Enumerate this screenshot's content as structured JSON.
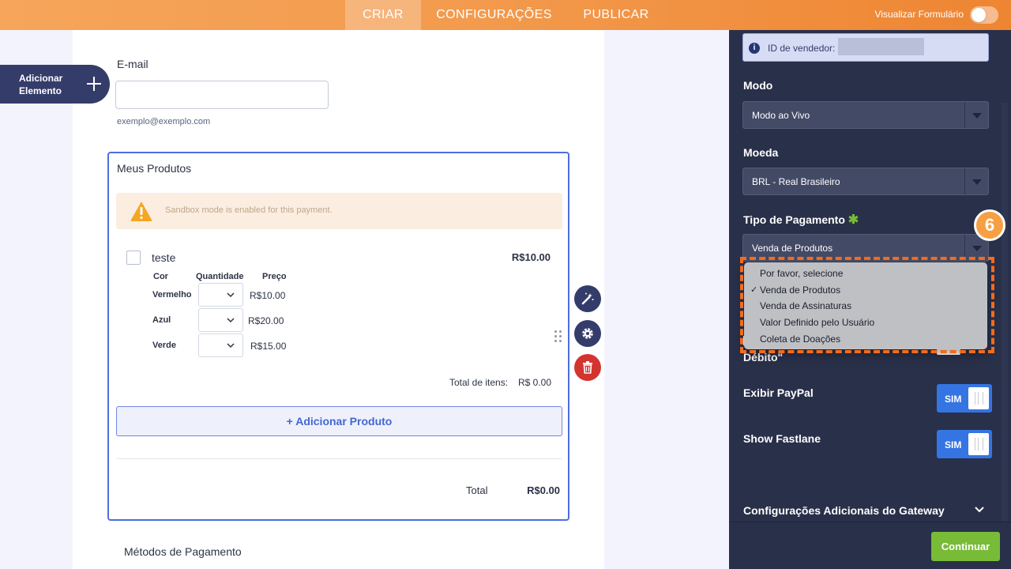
{
  "topbar": {
    "tabs": [
      {
        "label": "CRIAR",
        "active": true
      },
      {
        "label": "CONFIGURAÇÕES",
        "active": false
      },
      {
        "label": "PUBLICAR",
        "active": false
      }
    ],
    "preview_label": "Visualizar Formulário",
    "preview_on": false
  },
  "add_element": {
    "label_line1": "Adicionar",
    "label_line2": "Elemento"
  },
  "email": {
    "label": "E-mail",
    "value": "",
    "sublabel": "exemplo@exemplo.com"
  },
  "products": {
    "title": "Meus Produtos",
    "sandbox_notice": "Sandbox mode is enabled for this payment.",
    "product": {
      "name": "teste",
      "price": "R$10.00",
      "columns": [
        "Cor",
        "Quantidade",
        "Preço"
      ],
      "variants": [
        {
          "color": "Vermelho",
          "price": "R$10.00"
        },
        {
          "color": "Azul",
          "price": "R$20.00"
        },
        {
          "color": "Verde",
          "price": "R$15.00"
        }
      ]
    },
    "total_items_label": "Total de itens:",
    "total_items_value": "R$ 0.00",
    "add_product_label": "+ Adicionar Produto",
    "total_label": "Total",
    "total_value": "R$0.00"
  },
  "payment_methods_label": "Métodos de Pagamento",
  "panel": {
    "vendor_label": "ID de vendedor:",
    "mode": {
      "label": "Modo",
      "value": "Modo ao Vivo"
    },
    "currency": {
      "label": "Moeda",
      "value": "BRL - Real Brasileiro"
    },
    "payment_type": {
      "label": "Tipo de Pagamento",
      "required_mark": "✱",
      "value": "Venda de Produtos",
      "options": [
        {
          "label": "Por favor, selecione",
          "selected": false
        },
        {
          "label": "Venda de Produtos",
          "selected": true
        },
        {
          "label": "Venda de Assinaturas",
          "selected": false
        },
        {
          "label": "Valor Definido pelo Usuário",
          "selected": false
        },
        {
          "label": "Coleta de Doações",
          "selected": false
        }
      ],
      "check_mark": "✓"
    },
    "hidden_label_tail": "Débito\"",
    "show_paypal": {
      "label": "Exibir PayPal",
      "toggle": "SIM"
    },
    "show_fastlane": {
      "label": "Show Fastlane",
      "toggle": "SIM"
    },
    "gateway_settings": "Configurações Adicionais do Gateway",
    "continue_label": "Continuar"
  },
  "step_badge": "6",
  "colors": {
    "accent": "#f39b4e",
    "panel": "#293049",
    "primary_blue": "#3574e3",
    "success": "#78bb37",
    "highlight": "#f36b1c"
  }
}
